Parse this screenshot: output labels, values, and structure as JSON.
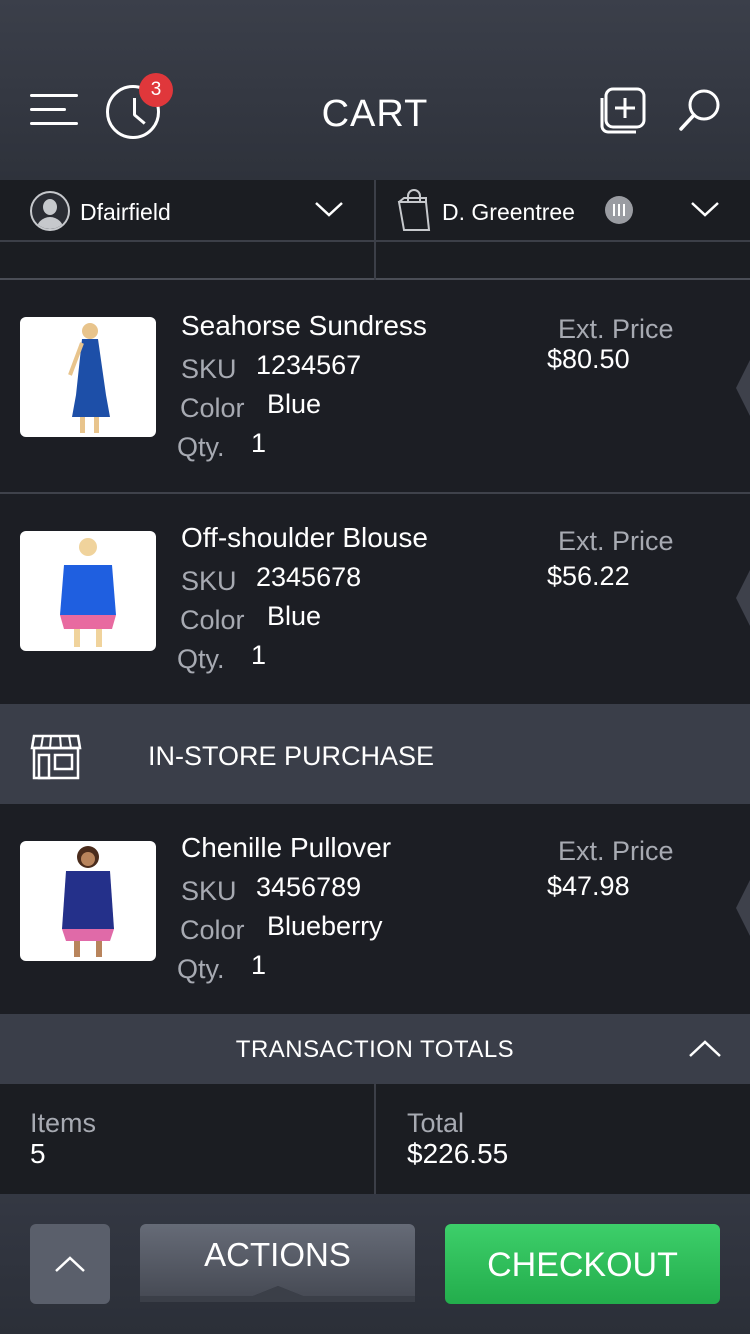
{
  "header": {
    "title": "CART",
    "notification_count": "3",
    "icons": [
      "menu-icon",
      "clock-icon",
      "add-item-icon",
      "search-icon"
    ]
  },
  "selectors": {
    "associate": "Dfairfield",
    "customer": "D. Greentree"
  },
  "labels": {
    "sku": "SKU",
    "color": "Color",
    "qty": "Qty.",
    "ext_price": "Ext. Price"
  },
  "items": [
    {
      "name": "Seahorse Sundress",
      "sku": "1234567",
      "color": "Blue",
      "qty": "1",
      "price": "$80.50"
    },
    {
      "name": "Off-shoulder Blouse",
      "sku": "2345678",
      "color": "Blue",
      "qty": "1",
      "price": "$56.22"
    },
    {
      "name": "Chenille Pullover",
      "sku": "3456789",
      "color": "Blueberry",
      "qty": "1",
      "price": "$47.98"
    }
  ],
  "instore": {
    "label": "IN-STORE PURCHASE"
  },
  "totals": {
    "title": "TRANSACTION TOTALS",
    "items_label": "Items",
    "items_value": "5",
    "total_label": "Total",
    "total_value": "$226.55"
  },
  "footer": {
    "actions_label": "ACTIONS",
    "checkout_label": "CHECKOUT"
  },
  "colors": {
    "background": "#1c1e24",
    "header": "#343843",
    "badge": "#e0373b",
    "checkout": "#2fbf5b"
  }
}
